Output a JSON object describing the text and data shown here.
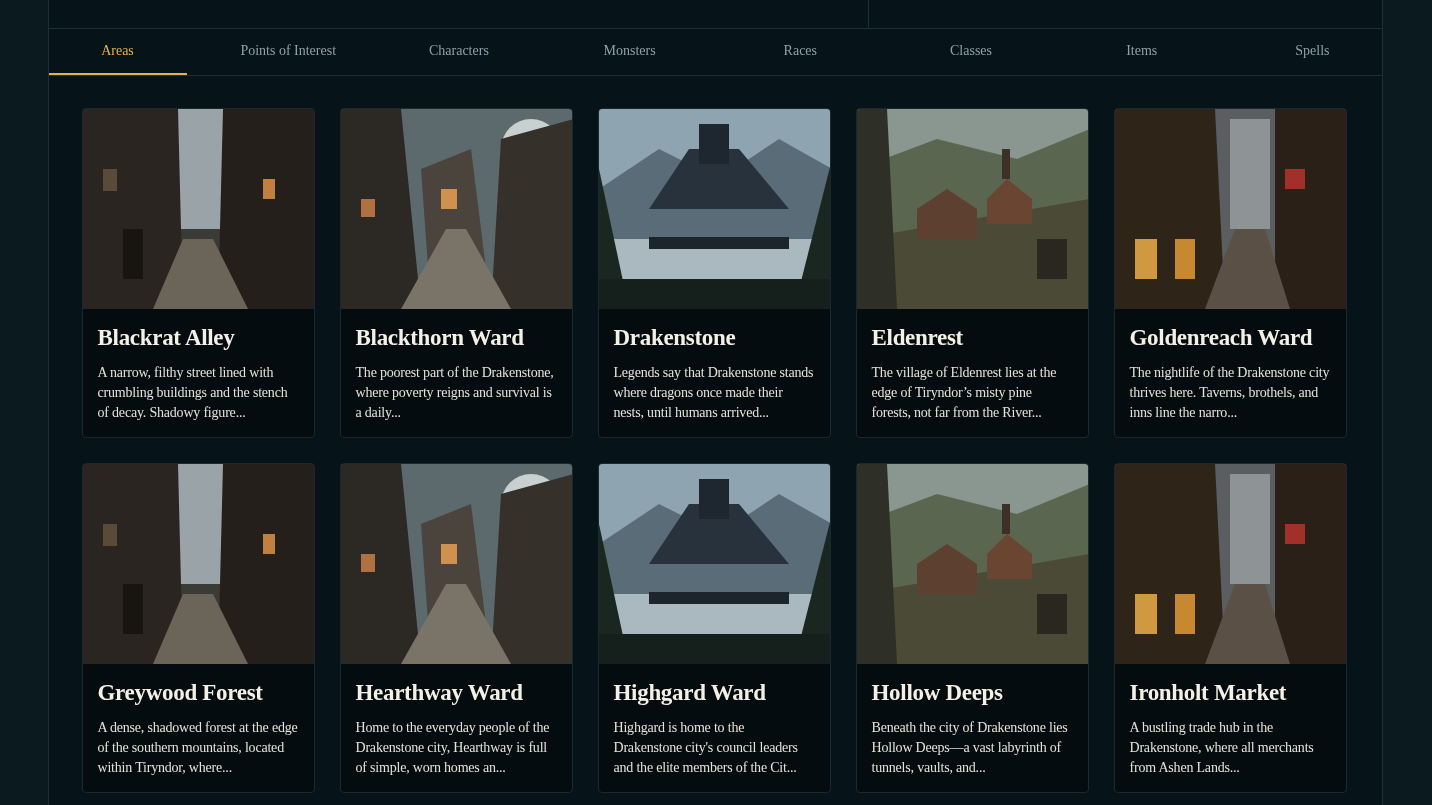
{
  "tabs": [
    {
      "label": "Areas",
      "selected": true
    },
    {
      "label": "Points of Interest",
      "selected": false
    },
    {
      "label": "Characters",
      "selected": false
    },
    {
      "label": "Monsters",
      "selected": false
    },
    {
      "label": "Races",
      "selected": false
    },
    {
      "label": "Classes",
      "selected": false
    },
    {
      "label": "Items",
      "selected": false
    },
    {
      "label": "Spells",
      "selected": false
    }
  ],
  "cards": [
    {
      "title": "Blackrat Alley",
      "description": "A narrow, filthy street lined with crumbling buildings and the stench of decay. Shadowy figure..."
    },
    {
      "title": "Blackthorn Ward",
      "description": "The poorest part of the Drakenstone, where poverty reigns and survival is a daily..."
    },
    {
      "title": "Drakenstone",
      "description": "Legends say that Drakenstone stands where dragons once made their nests, until humans arrived..."
    },
    {
      "title": "Eldenrest",
      "description": "The village of Eldenrest lies at the edge of Tiryndor’s misty pine forests, not far from the River..."
    },
    {
      "title": "Goldenreach Ward",
      "description": "The nightlife of the Drakenstone city thrives here. Taverns, brothels, and inns line the narro..."
    },
    {
      "title": "Greywood Forest",
      "description": "A dense, shadowed forest at the edge of the southern mountains, located within Tiryndor, where..."
    },
    {
      "title": "Hearthway Ward",
      "description": "Home to the everyday people of the Drakenstone city, Hearthway is full of simple, worn homes an..."
    },
    {
      "title": "Highgard Ward",
      "description": "Highgard is home to the Drakenstone city's council leaders and the elite members of the Cit..."
    },
    {
      "title": "Hollow Deeps",
      "description": "Beneath the city of Drakenstone lies Hollow Deeps—a vast labyrinth of tunnels, vaults, and..."
    },
    {
      "title": "Ironholt Market",
      "description": "A bustling trade hub in the Drakenstone, where all merchants from Ashen Lands..."
    }
  ]
}
